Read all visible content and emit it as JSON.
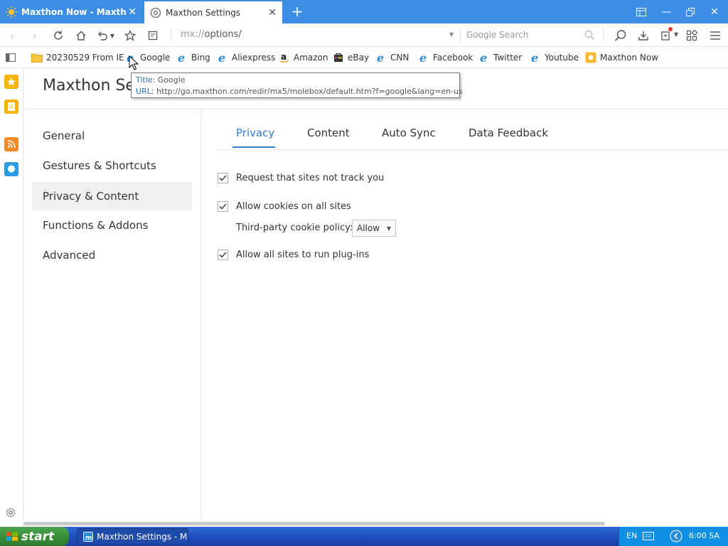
{
  "browser": {
    "tabs": [
      {
        "title": "Maxthon Now - Maxthon S",
        "active": false
      },
      {
        "title": "Maxthon Settings",
        "active": true
      }
    ],
    "address": {
      "scheme": "mx://",
      "path": "options/"
    },
    "search_placeholder": "Google Search",
    "bookmarks": [
      {
        "label": "20230529 From IE",
        "icon": "folder-icon"
      },
      {
        "label": "Google",
        "icon": "ie-icon"
      },
      {
        "label": "Bing",
        "icon": "ie-icon"
      },
      {
        "label": "Aliexpress",
        "icon": "ie-icon"
      },
      {
        "label": "Amazon",
        "icon": "amazon-icon"
      },
      {
        "label": "eBay",
        "icon": "ebay-icon"
      },
      {
        "label": "CNN",
        "icon": "ie-icon"
      },
      {
        "label": "Facebook",
        "icon": "ie-icon"
      },
      {
        "label": "Twitter",
        "icon": "ie-icon"
      },
      {
        "label": "Youtube",
        "icon": "ie-icon"
      },
      {
        "label": "Maxthon Now",
        "icon": "maxthon-now-icon"
      }
    ],
    "tooltip": {
      "title_label": "Title:",
      "title_value": "Google",
      "url_label": "URL:",
      "url_value": "http://go.maxthon.com/redir/mx5/molebox/default.htm?f=google&lang=en-us"
    }
  },
  "settings": {
    "page_title": "Maxthon Settings",
    "nav": [
      "General",
      "Gestures & Shortcuts",
      "Privacy & Content",
      "Functions & Addons",
      "Advanced"
    ],
    "active_nav": "Privacy & Content",
    "tabs": [
      "Privacy",
      "Content",
      "Auto Sync",
      "Data Feedback"
    ],
    "active_tab": "Privacy",
    "options": {
      "do_not_track": {
        "label": "Request that sites not track you",
        "checked": true
      },
      "allow_cookies": {
        "label": "Allow cookies on all sites",
        "checked": true
      },
      "third_party_label": "Third-party cookie policy:",
      "third_party_value": "Allow",
      "plugins": {
        "label": "Allow all sites to run plug-ins",
        "checked": true
      }
    }
  },
  "taskbar": {
    "start_label": "start",
    "task_label": "Maxthon Settings - M...",
    "language": "EN",
    "clock": "6:00 SA"
  },
  "colors": {
    "tabbar": "#3b8de6",
    "accent": "#2c7fd6",
    "taskbar": "#245edb",
    "start": "#3a8e3a"
  }
}
